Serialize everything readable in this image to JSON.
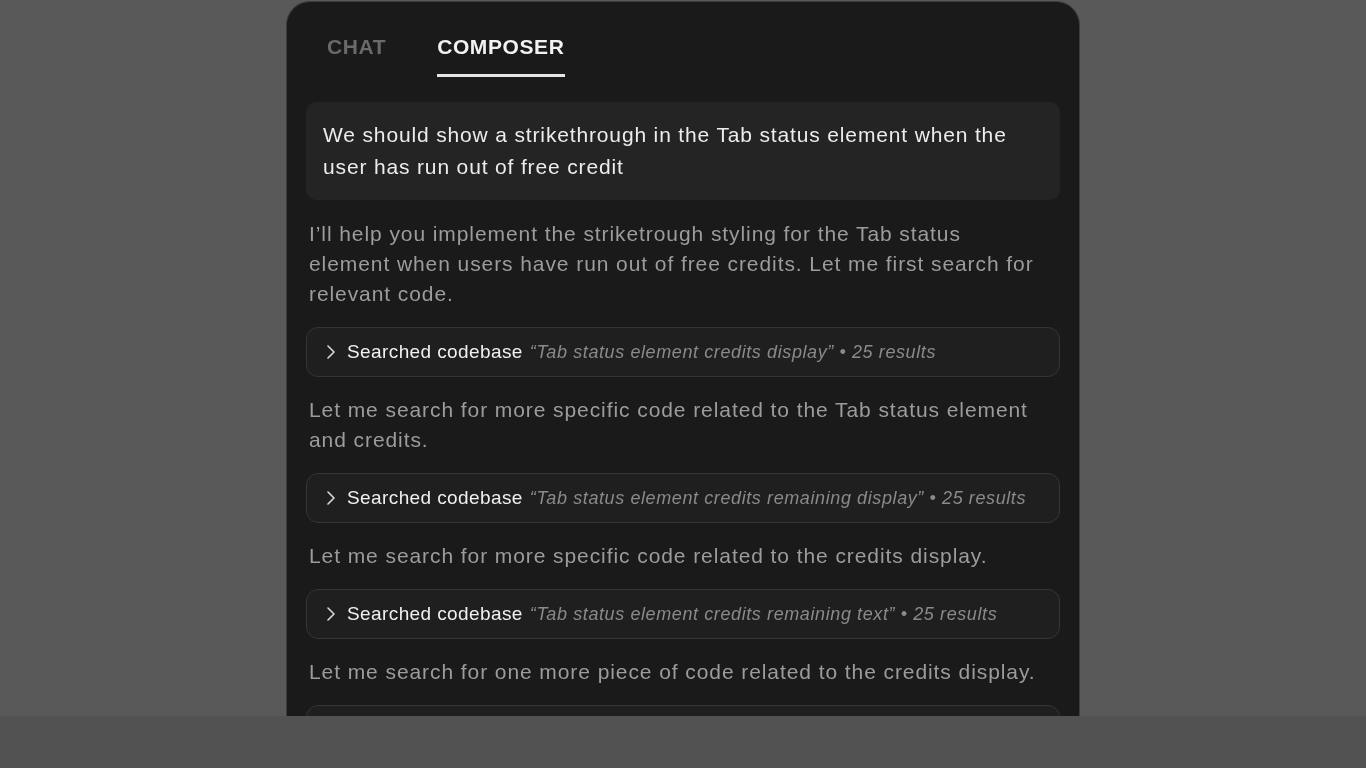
{
  "tabs": [
    {
      "label": "CHAT",
      "selected": false
    },
    {
      "label": "COMPOSER",
      "selected": true
    }
  ],
  "messages": [
    {
      "kind": "user",
      "text": "We should show a strikethrough in the Tab status element when the user has run out of free credit"
    },
    {
      "kind": "assistant",
      "text": "I’ll help you implement the striketrough styling for the Tab status element when users have run out of free credits. Let me first search for relevant code."
    },
    {
      "kind": "search",
      "label": "Searched codebase",
      "detail": "“Tab status element credits display” • 25 results",
      "expanded": false
    },
    {
      "kind": "assistant",
      "text": "Let me search for more specific code related to the Tab status element and credits."
    },
    {
      "kind": "search",
      "label": "Searched codebase",
      "detail": "“Tab status element credits remaining display” • 25 results",
      "expanded": false
    },
    {
      "kind": "assistant",
      "text": "Let me search for more specific code related to the credits display."
    },
    {
      "kind": "search",
      "label": "Searched codebase",
      "detail": "“Tab status element credits remaining text” • 25 results",
      "expanded": false
    },
    {
      "kind": "assistant",
      "text": "Let me search for one more piece of code related to the credits display."
    },
    {
      "kind": "cutoff"
    }
  ]
}
